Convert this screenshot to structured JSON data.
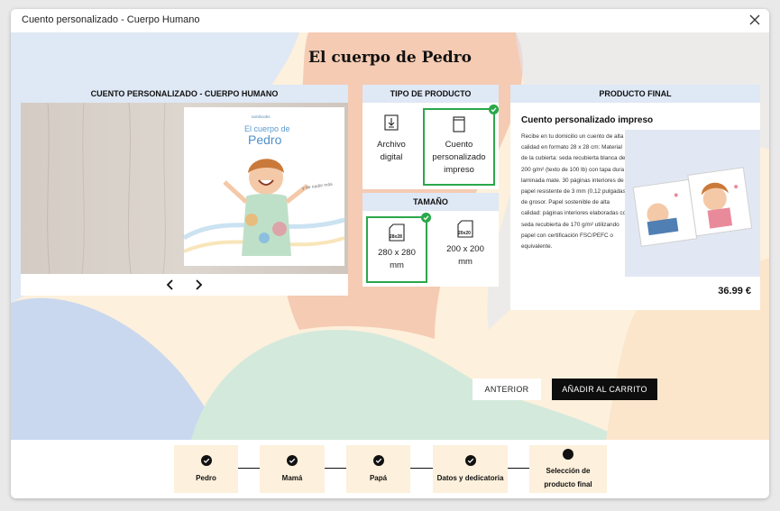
{
  "window": {
    "title": "Cuento personalizado - Cuerpo Humano"
  },
  "book_title": "El cuerpo de Pedro",
  "preview": {
    "header": "CUENTO PERSONALIZADO - CUERPO HUMANO",
    "cover_brand": "Iamibooks",
    "cover_line1": "El cuerpo de",
    "cover_name": "Pedro",
    "cover_tagline": "y de nadie más"
  },
  "product_type": {
    "header": "TIPO DE PRODUCTO",
    "options": [
      {
        "line1": "Archivo",
        "line2": "digital",
        "icon": "download-icon",
        "selected": false
      },
      {
        "line1": "Cuento",
        "line2": "personalizado",
        "line3": "impreso",
        "icon": "book-icon",
        "selected": true
      }
    ]
  },
  "size": {
    "header": "TAMAÑO",
    "options": [
      {
        "badge": "28x28",
        "line1": "280 x 280",
        "line2": "mm",
        "selected": true
      },
      {
        "badge": "20x20",
        "line1": "200 x 200",
        "line2": "mm",
        "selected": false
      }
    ]
  },
  "final_product": {
    "header": "PRODUCTO FINAL",
    "title": "Cuento personalizado impreso",
    "description": "Recibe en tu domicilio un cuento de alta calidad en formato 28 x 28 cm: Material de la cubierta: seda recubierta blanca de 200 g/m² (texto de 100 lb) con tapa dura laminada mate. 30 páginas interiores de papel resistente de 3 mm (0,12 pulgadas) de grosor. Papel sostenible de alta calidad: páginas interiores elaboradas con seda recubierta de 170 g/m² utilizando papel con certificación FSC/PEFC o equivalente.",
    "price": "36.99 €"
  },
  "buttons": {
    "previous": "ANTERIOR",
    "add_to_cart": "AÑADIR AL CARRITO"
  },
  "steps": [
    {
      "label": "Pedro",
      "status": "done"
    },
    {
      "label": "Mamá",
      "status": "done"
    },
    {
      "label": "Papá",
      "status": "done"
    },
    {
      "label": "Datos y dedicatoria",
      "status": "done"
    },
    {
      "label_line1": "Selección de",
      "label_line2": "producto final",
      "status": "current"
    }
  ],
  "colors": {
    "accent_green": "#2aa84a",
    "header_blue": "#dfe8f5",
    "cream": "#fdf0dc",
    "peach": "#f5cbb3",
    "mint": "#d3e9dc"
  }
}
